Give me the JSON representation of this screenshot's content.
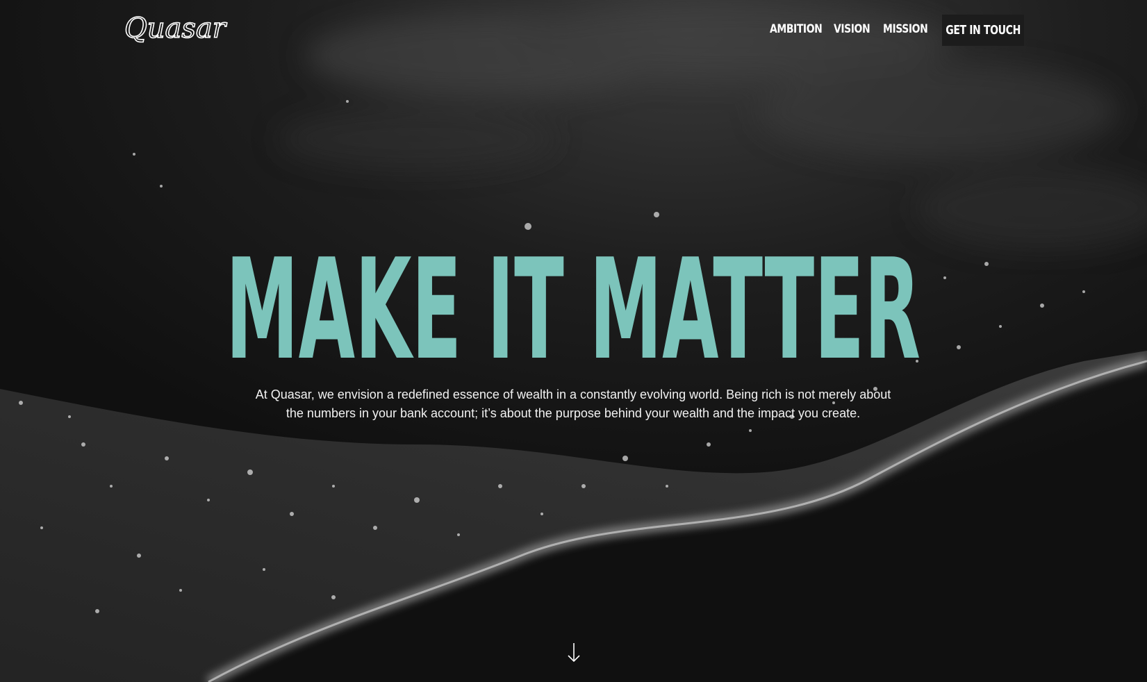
{
  "brand": {
    "logo_text": "Quasar"
  },
  "nav": {
    "items": [
      {
        "label": "AMBITION"
      },
      {
        "label": "VISION"
      },
      {
        "label": "MISSION"
      }
    ],
    "cta_label": "GET IN TOUCH"
  },
  "hero": {
    "headline": "MAKE IT MATTER",
    "description": "At Quasar, we envision a redefined essence of wealth in a constantly evolving world. Being rich is not merely about the numbers in your bank account; it’s about the purpose behind your wealth and the impact you create.",
    "scroll_icon": "arrow-down-icon"
  },
  "colors": {
    "accent": "#7cc4bb",
    "background": "#0d0d0d",
    "text": "#ffffff",
    "cta_background": "#1c1c1c"
  }
}
